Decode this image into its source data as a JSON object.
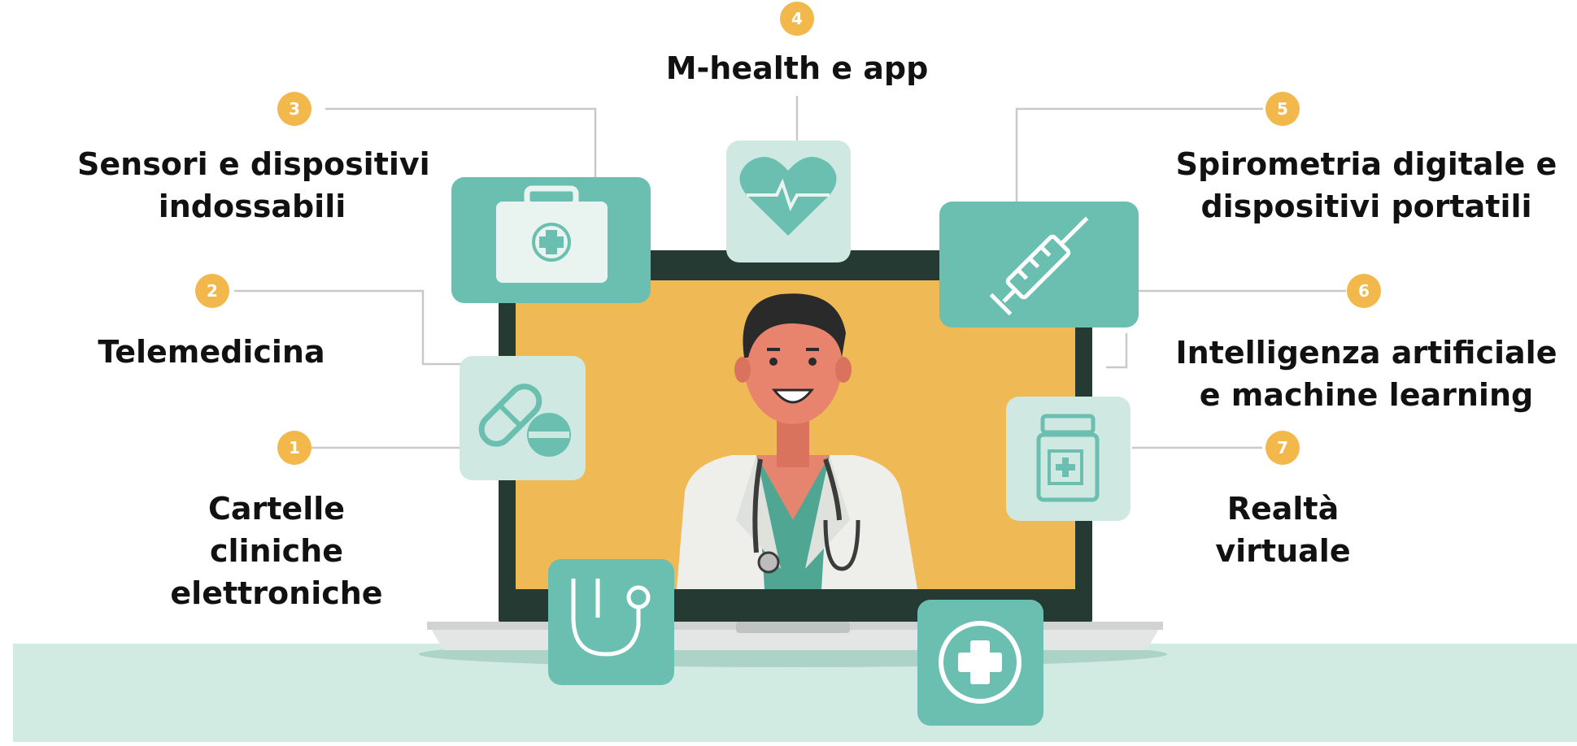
{
  "items": [
    {
      "num": "1",
      "lines": [
        "Cartelle",
        "cliniche",
        "elettroniche"
      ]
    },
    {
      "num": "2",
      "lines": [
        "Telemedicina"
      ]
    },
    {
      "num": "3",
      "lines": [
        "Sensori e dispositivi",
        "indossabili"
      ]
    },
    {
      "num": "4",
      "lines": [
        "M-health e app"
      ]
    },
    {
      "num": "5",
      "lines": [
        "Spirometria digitale e",
        "dispositivi portatili"
      ]
    },
    {
      "num": "6",
      "lines": [
        "Intelligenza artificiale",
        "e machine learning"
      ]
    },
    {
      "num": "7",
      "lines": [
        "Realtà",
        "virtuale"
      ]
    }
  ],
  "icons": [
    "first-aid-kit-icon",
    "heart-rate-icon",
    "syringe-icon",
    "pills-icon",
    "medicine-bottle-icon",
    "stethoscope-icon",
    "medical-cross-icon"
  ],
  "colors": {
    "badge": "#f2b84b",
    "tile_dark": "#6bbfb0",
    "tile_light": "#cfe9e2",
    "floor": "#d2ebe2",
    "screen": "#efba55",
    "laptop_frame": "#253a33",
    "connector": "#c9c9c9"
  }
}
